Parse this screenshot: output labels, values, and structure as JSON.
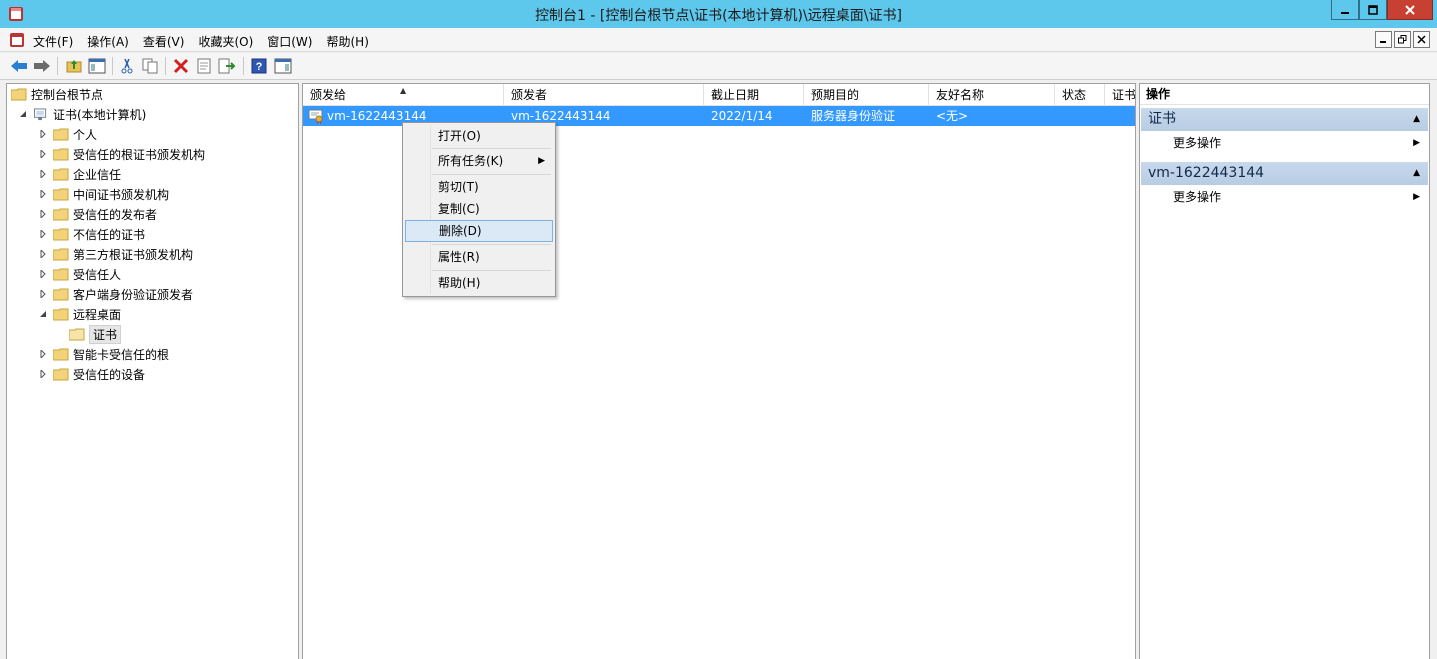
{
  "window": {
    "title": "控制台1 - [控制台根节点\\证书(本地计算机)\\远程桌面\\证书]"
  },
  "menu": [
    "文件(F)",
    "操作(A)",
    "查看(V)",
    "收藏夹(O)",
    "窗口(W)",
    "帮助(H)"
  ],
  "toolbar_icons": [
    "back-arrow-icon",
    "forward-arrow-icon",
    "up-folder-icon",
    "show-hide-tree-icon",
    "cut-icon",
    "copy-icon",
    "delete-icon",
    "properties-icon",
    "export-icon",
    "help-icon",
    "show-hide-action-pane-icon"
  ],
  "tree": {
    "root": "控制台根节点",
    "cert_store": "证书(本地计算机)",
    "items": [
      "个人",
      "受信任的根证书颁发机构",
      "企业信任",
      "中间证书颁发机构",
      "受信任的发布者",
      "不信任的证书",
      "第三方根证书颁发机构",
      "受信任人",
      "客户端身份验证颁发者",
      "远程桌面"
    ],
    "remote_child": "证书",
    "after_items": [
      "智能卡受信任的根",
      "受信任的设备"
    ]
  },
  "list": {
    "columns": [
      "颁发给",
      "颁发者",
      "截止日期",
      "预期目的",
      "友好名称",
      "状态",
      "证书"
    ],
    "rows": [
      {
        "issued_to": "vm-1622443144",
        "issued_by": "vm-1622443144",
        "expiry": "2022/1/14",
        "purpose": "服务器身份验证",
        "friendly": "<无>"
      }
    ]
  },
  "context_menu": {
    "open": "打开(O)",
    "all_tasks": "所有任务(K)",
    "cut": "剪切(T)",
    "copy": "复制(C)",
    "delete": "删除(D)",
    "properties": "属性(R)",
    "help": "帮助(H)"
  },
  "actions": {
    "header": "操作",
    "section1": "证书",
    "section1_more": "更多操作",
    "section2": "vm-1622443144",
    "section2_more": "更多操作"
  },
  "colors": {
    "titlebar": "#5ec8ec",
    "selection": "#3399ff",
    "close_button": "#c84031",
    "action_section": "#c8d9ec"
  }
}
